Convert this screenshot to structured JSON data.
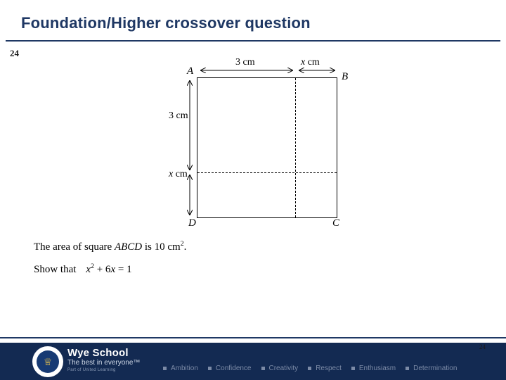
{
  "slide": {
    "title": "Foundation/Higher crossover question",
    "question_number": "24"
  },
  "figure": {
    "vertex_A": "A",
    "vertex_B": "B",
    "vertex_C": "C",
    "vertex_D": "D",
    "top_left_label": "3 cm",
    "top_right_label_var": "x",
    "top_right_label_unit": "cm",
    "left_top_label": "3 cm",
    "left_bottom_label_var": "x",
    "left_bottom_label_unit": "cm"
  },
  "question": {
    "statement_part1": "The area of square ",
    "statement_abcd": "ABCD",
    "statement_part2": " is 10 cm",
    "statement_sup": "2",
    "statement_part3": ".",
    "show_that_label": "Show that",
    "equation_x": "x",
    "equation_sup": "2",
    "equation_rest": " + 6",
    "equation_x2": "x",
    "equation_end": " = 1"
  },
  "footer": {
    "school_name": "Wye School",
    "tagline": "The best in everyone™",
    "subline": "Part of United Learning",
    "values": [
      "Ambition",
      "Confidence",
      "Creativity",
      "Respect",
      "Enthusiasm",
      "Determination"
    ],
    "page_number": "24",
    "logo_glyph": "♕"
  },
  "colors": {
    "title": "#1f3864",
    "footer_band": "#132a52",
    "value_text": "#7b8aa6"
  }
}
